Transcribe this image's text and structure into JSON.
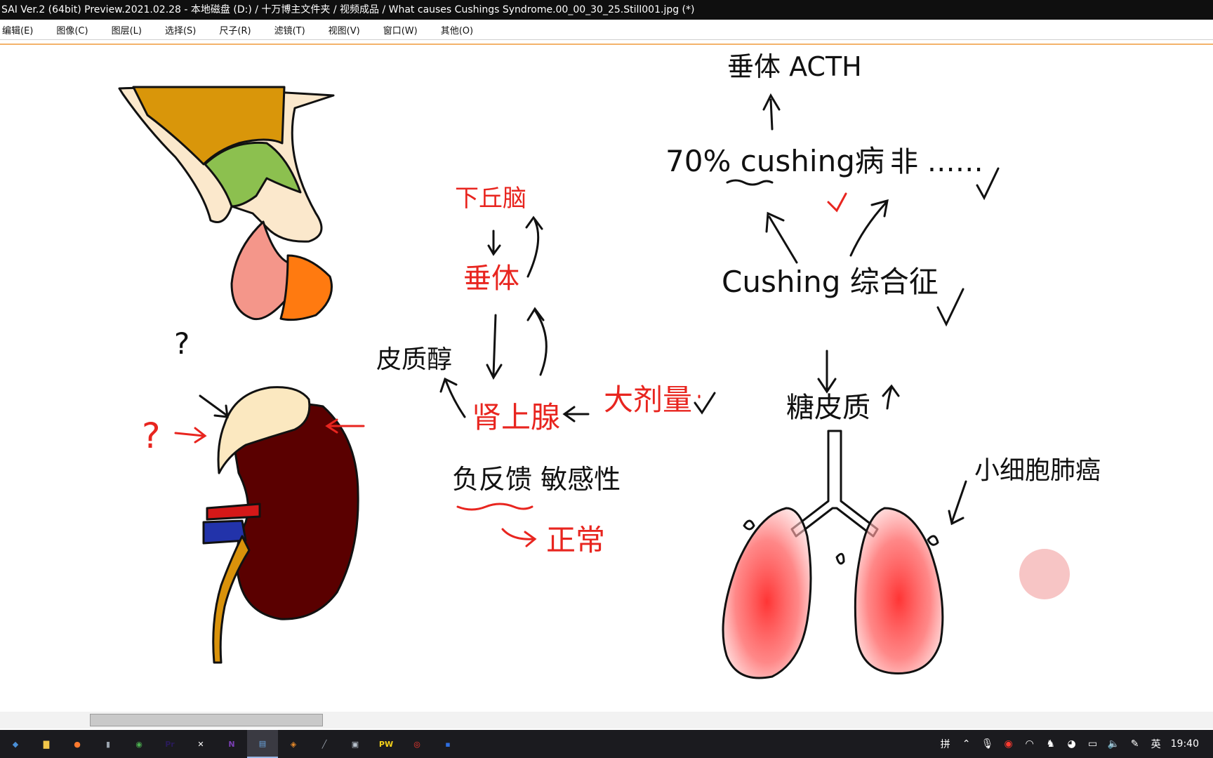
{
  "window": {
    "title": "SAI Ver.2 (64bit) Preview.2021.02.28 - 本地磁盘 (D:) / 十万博主文件夹 / 视频成品 / What causes Cushings Syndrome.00_00_30_25.Still001.jpg (*)"
  },
  "menu": {
    "items": [
      "编辑(E)",
      "图像(C)",
      "图层(L)",
      "选择(S)",
      "尺子(R)",
      "滤镜(T)",
      "视图(V)",
      "窗口(W)",
      "其他(O)"
    ]
  },
  "drawing": {
    "pituitary_acth": "垂体 ACTH",
    "cushing_disease": "70% cushing病",
    "non_other": "非 ……",
    "cushing_syndrome": "Cushing 综合征",
    "glucocorticoid": "糖皮质",
    "hypothalamus": "下丘脑",
    "pituitary": "垂体",
    "cortisol": "皮质醇",
    "adrenal": "肾上腺",
    "large_dose": "大剂量",
    "negative_feedback": "负反馈 敏感性",
    "normal": "正常",
    "small_cell_lung_cancer": "小细胞肺癌",
    "question_black": "?",
    "question_red": "?"
  },
  "colors": {
    "red_ink": "#e8251f",
    "black_ink": "#111111"
  },
  "taskbar": {
    "apps": [
      {
        "icon": "app-icon",
        "glyph": "◆",
        "color": "#4a8fd6"
      },
      {
        "icon": "file-explorer-icon",
        "glyph": "▇",
        "color": "#f2c64a"
      },
      {
        "icon": "firefox-icon",
        "glyph": "●",
        "color": "#ff7a2e"
      },
      {
        "icon": "usb-icon",
        "glyph": "▮",
        "color": "#9aa3ad"
      },
      {
        "icon": "chrome-icon",
        "glyph": "◉",
        "color": "#4caf50"
      },
      {
        "icon": "premiere-icon",
        "glyph": "Pr",
        "color": "#2a1b5a"
      },
      {
        "icon": "capcut-icon",
        "glyph": "✕",
        "color": "#ffffff"
      },
      {
        "icon": "onenote-icon",
        "glyph": "N",
        "color": "#7b3fb5"
      },
      {
        "icon": "sai-icon",
        "glyph": "▤",
        "color": "#6aa6e0"
      },
      {
        "icon": "blender-icon",
        "glyph": "◈",
        "color": "#e98b2a"
      },
      {
        "icon": "pen-icon",
        "glyph": "╱",
        "color": "#9aa3ad"
      },
      {
        "icon": "camera-icon",
        "glyph": "▣",
        "color": "#b8c2cc"
      },
      {
        "icon": "pw-icon",
        "glyph": "PW",
        "color": "#f5d21a"
      },
      {
        "icon": "record-icon",
        "glyph": "◎",
        "color": "#ff3b30"
      },
      {
        "icon": "misc-icon",
        "glyph": "▪",
        "color": "#2f6fe0"
      }
    ],
    "tray": {
      "ime_grid": "拼",
      "lang": "英",
      "time": "19:40"
    }
  }
}
